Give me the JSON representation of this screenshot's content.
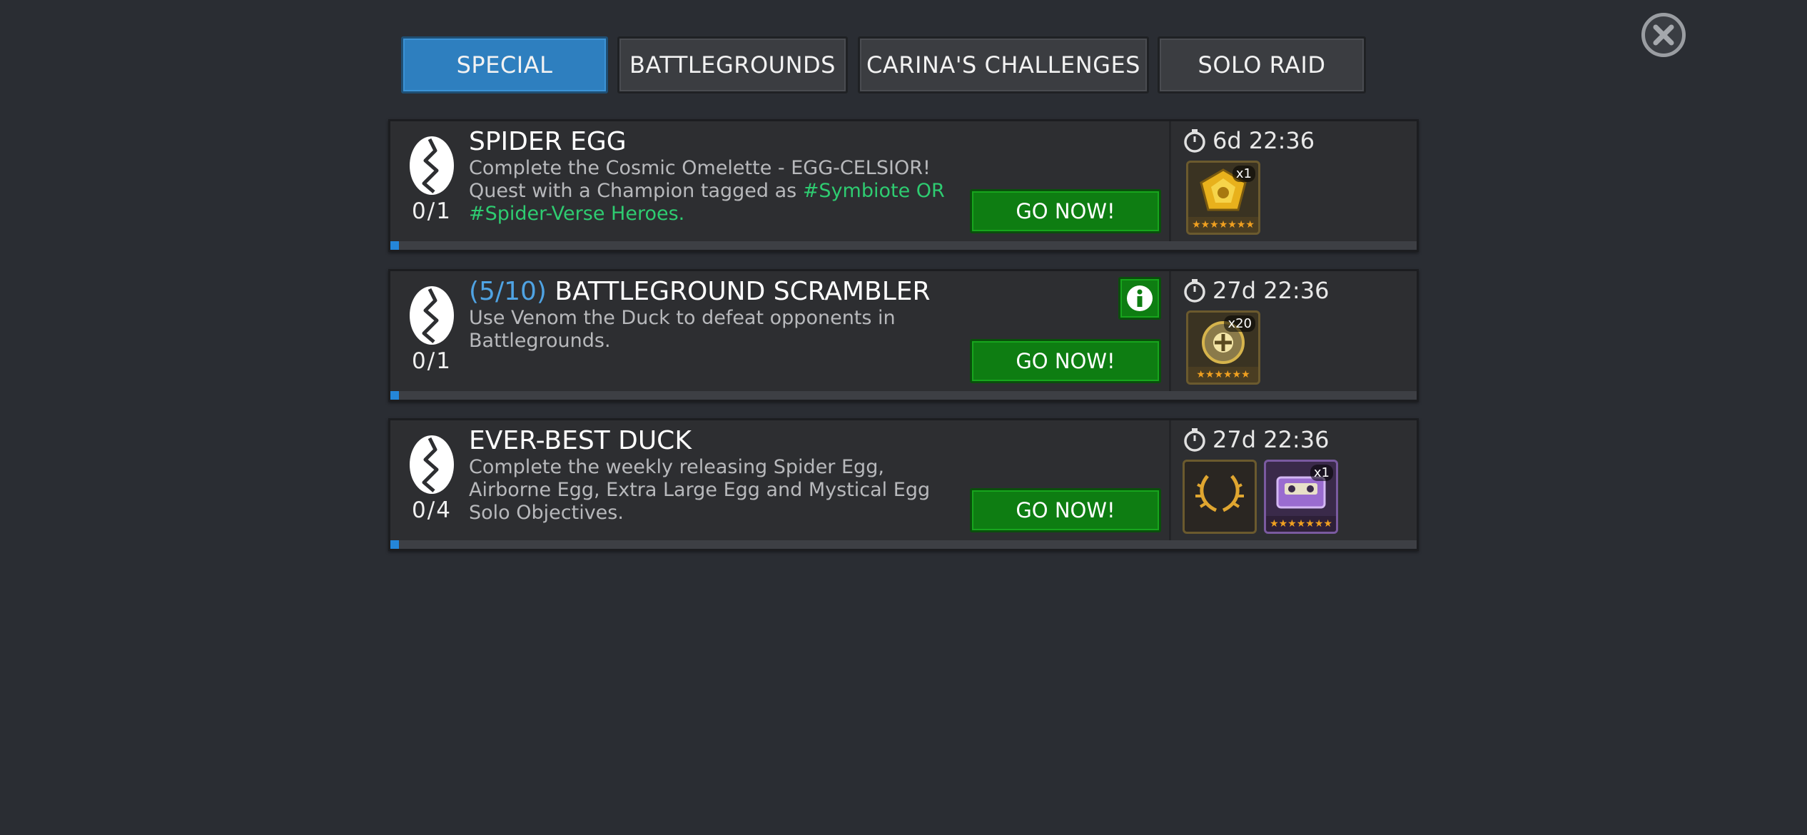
{
  "tabs": [
    {
      "label": "SPECIAL",
      "active": true
    },
    {
      "label": "BATTLEGROUNDS",
      "active": false
    },
    {
      "label": "CARINA'S CHALLENGES",
      "active": false
    },
    {
      "label": "SOLO RAID",
      "active": false
    }
  ],
  "close_icon": "close-icon",
  "quests": [
    {
      "title": "SPIDER EGG",
      "title_prefix": "",
      "progress_text": "0/1",
      "progress": 0,
      "desc_plain": "Complete the Cosmic Omelette - EGG-CELSIOR! Quest with a Champion tagged as ",
      "desc_tag": "#Symbiote OR #Spider-Verse Heroes.",
      "timer": "6d 22:36",
      "go_label": "GO NOW!",
      "has_info": false,
      "rewards": [
        {
          "icon": "gold-crystal-icon",
          "qty": "x1",
          "stars": "★★★★★★★"
        }
      ]
    },
    {
      "title": "BATTLEGROUND SCRAMBLER",
      "title_prefix": "(5/10)",
      "progress_text": "0/1",
      "progress": 0,
      "desc_plain": "Use Venom the Duck to defeat opponents in Battlegrounds.",
      "desc_tag": "",
      "timer": "27d 22:36",
      "go_label": "GO NOW!",
      "has_info": true,
      "rewards": [
        {
          "icon": "gear-crystal-icon",
          "qty": "x20",
          "stars": "★★★★★★"
        }
      ]
    },
    {
      "title": "EVER-BEST DUCK",
      "title_prefix": "",
      "progress_text": "0/4",
      "progress": 0,
      "desc_plain": "Complete the weekly releasing Spider Egg, Airborne Egg, Extra Large Egg and Mystical Egg Solo Objectives.",
      "desc_tag": "",
      "timer": "27d 22:36",
      "go_label": "GO NOW!",
      "has_info": false,
      "rewards": [
        {
          "icon": "laurel-wreath-icon",
          "qty": "",
          "stars": ""
        },
        {
          "icon": "cassette-tape-icon",
          "qty": "x1",
          "stars": "★★★★★★★"
        }
      ]
    }
  ],
  "colors": {
    "background": "#2a2d33",
    "active_tab": "#2e7fbf",
    "go_button": "#0e7d12",
    "tag_text": "#2ecc71",
    "prefix_text": "#4fa3e3",
    "progress_fill": "#2486d9"
  }
}
